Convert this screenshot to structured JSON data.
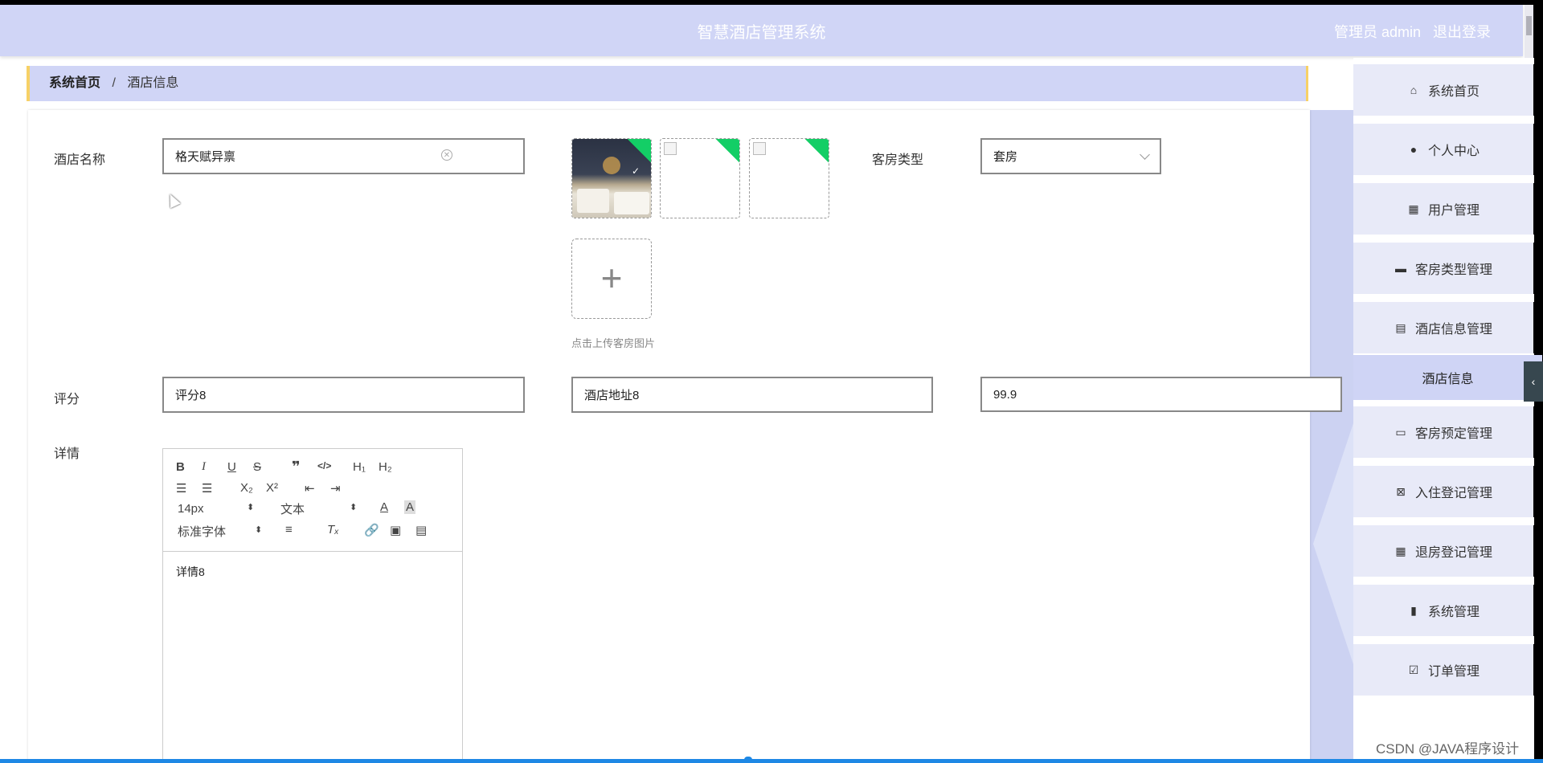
{
  "header": {
    "title": "智慧酒店管理系统",
    "user": "管理员 admin",
    "logout": "退出登录"
  },
  "breadcrumb": {
    "home": "系统首页",
    "separator": "/",
    "current": "酒店信息"
  },
  "form": {
    "hotel_name_label": "酒店名称",
    "hotel_name_value": "格天赋异禀",
    "room_type_label": "客房类型",
    "room_type_value": "套房",
    "upload_hint": "点击上传客房图片",
    "rating_label": "评分",
    "rating_value": "评分8",
    "address_value": "酒店地址8",
    "price_value": "99.9",
    "detail_label": "详情",
    "editor": {
      "font_size": "14px",
      "text_style": "文本",
      "font_family": "标准字体",
      "content": "详情8"
    }
  },
  "sidebar": {
    "items": [
      {
        "label": "系统首页",
        "icon": "home-icon"
      },
      {
        "label": "个人中心",
        "icon": "person-icon"
      },
      {
        "label": "用户管理",
        "icon": "grid-icon"
      },
      {
        "label": "客房类型管理",
        "icon": "briefcase-icon"
      },
      {
        "label": "酒店信息管理",
        "icon": "clipboard-icon"
      },
      {
        "label": "客房预定管理",
        "icon": "monitor-icon"
      },
      {
        "label": "入住登记管理",
        "icon": "clipboard-x-icon"
      },
      {
        "label": "退房登记管理",
        "icon": "grid-icon"
      },
      {
        "label": "系统管理",
        "icon": "bar-chart-icon"
      },
      {
        "label": "订单管理",
        "icon": "clipboard-check-icon"
      }
    ],
    "submenu": "酒店信息"
  },
  "watermark": "CSDN @JAVA程序设计",
  "colors": {
    "header_bg": "#d0d5f6",
    "breadcrumb_border": "#f7d166",
    "upload_badge": "#13ce66"
  }
}
